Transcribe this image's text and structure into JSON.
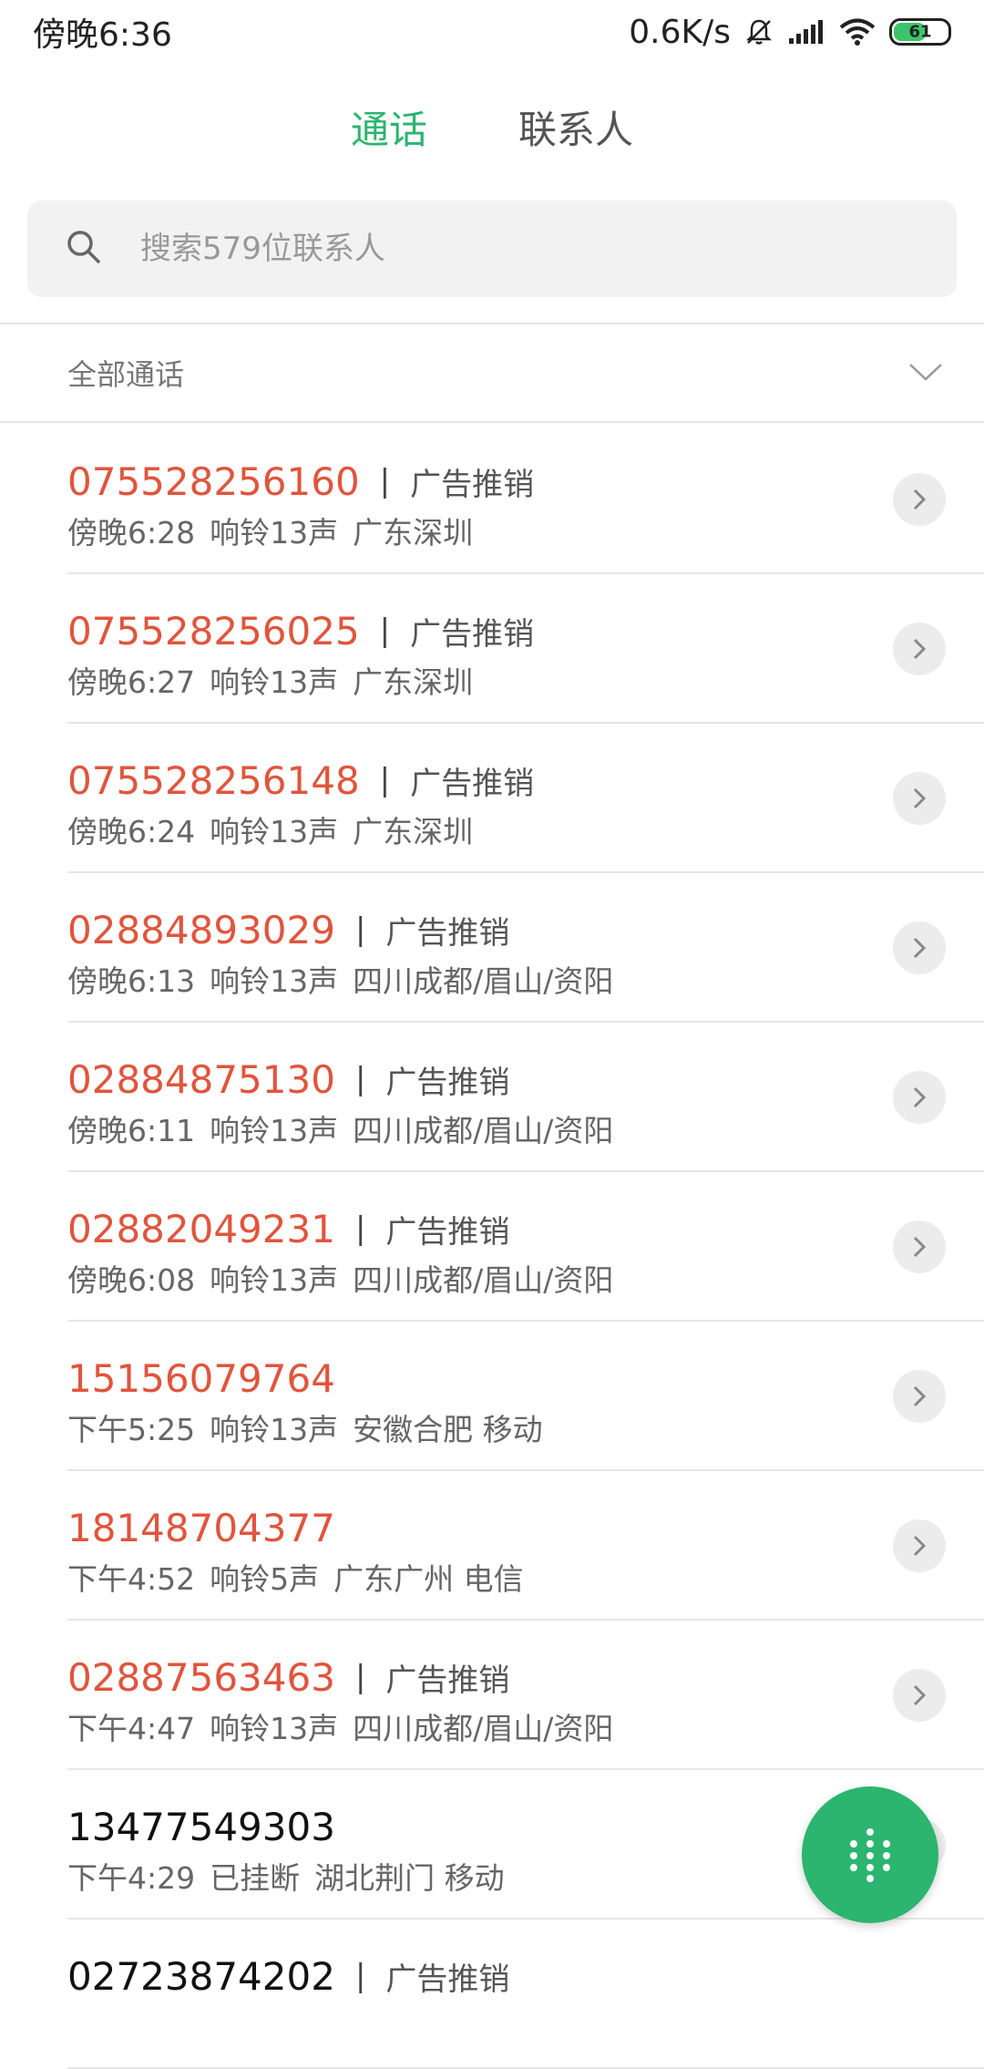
{
  "status_bar": {
    "time": "傍晚6:36",
    "net_speed": "0.6K/s",
    "battery": "61"
  },
  "tabs": [
    {
      "label": "通话",
      "active": true
    },
    {
      "label": "联系人",
      "active": false
    }
  ],
  "search": {
    "placeholder": "搜索579位联系人"
  },
  "filter": {
    "label": "全部通话"
  },
  "calls": [
    {
      "number": "075528256160",
      "tag": "广告推销",
      "time": "傍晚6:28",
      "status": "响铃13声",
      "location": "广东深圳",
      "missed": true
    },
    {
      "number": "075528256025",
      "tag": "广告推销",
      "time": "傍晚6:27",
      "status": "响铃13声",
      "location": "广东深圳",
      "missed": true
    },
    {
      "number": "075528256148",
      "tag": "广告推销",
      "time": "傍晚6:24",
      "status": "响铃13声",
      "location": "广东深圳",
      "missed": true
    },
    {
      "number": "02884893029",
      "tag": "广告推销",
      "time": "傍晚6:13",
      "status": "响铃13声",
      "location": "四川成都/眉山/资阳",
      "missed": true
    },
    {
      "number": "02884875130",
      "tag": "广告推销",
      "time": "傍晚6:11",
      "status": "响铃13声",
      "location": "四川成都/眉山/资阳",
      "missed": true
    },
    {
      "number": "02882049231",
      "tag": "广告推销",
      "time": "傍晚6:08",
      "status": "响铃13声",
      "location": "四川成都/眉山/资阳",
      "missed": true
    },
    {
      "number": "15156079764",
      "tag": "",
      "time": "下午5:25",
      "status": "响铃13声",
      "location": "安徽合肥 移动",
      "missed": true
    },
    {
      "number": "18148704377",
      "tag": "",
      "time": "下午4:52",
      "status": "响铃5声",
      "location": "广东广州 电信",
      "missed": true
    },
    {
      "number": "02887563463",
      "tag": "广告推销",
      "time": "下午4:47",
      "status": "响铃13声",
      "location": "四川成都/眉山/资阳",
      "missed": true
    },
    {
      "number": "13477549303",
      "tag": "",
      "time": "下午4:29",
      "status": "已挂断",
      "location": "湖北荆门 移动",
      "missed": false
    },
    {
      "number": "02723874202",
      "tag": "广告推销",
      "time": "",
      "status": "",
      "location": "",
      "missed": false
    }
  ],
  "colors": {
    "accent": "#2bb56e",
    "missed": "#e0553d"
  },
  "icons": {
    "search": "search-icon",
    "filter": "chevron-down-icon",
    "detail": "chevron-right-icon",
    "dialpad": "dialpad-icon"
  }
}
